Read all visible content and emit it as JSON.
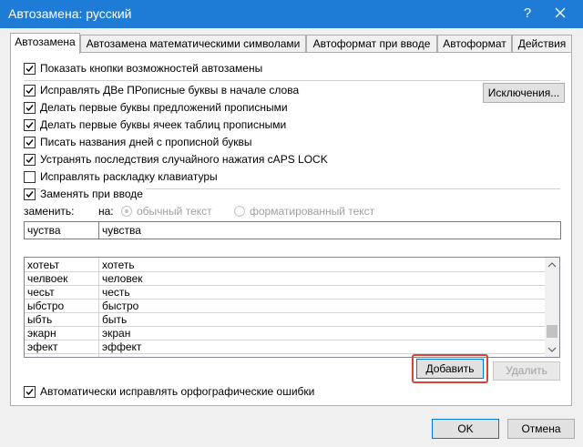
{
  "window": {
    "title": "Автозамена: русский",
    "help": "?"
  },
  "tabs": [
    "Автозамена",
    "Автозамена математическими символами",
    "Автоформат при вводе",
    "Автоформат",
    "Действия"
  ],
  "options": {
    "show_buttons": "Показать кнопки возможностей автозамены",
    "two_caps": "Исправлять ДВе ПРописные буквы в начале слова",
    "sentence_caps": "Делать первые буквы предложений прописными",
    "cell_caps": "Делать первые буквы ячеек таблиц прописными",
    "day_names": "Писать названия дней с прописной буквы",
    "caps_lock": "Устранять последствия случайного нажатия cAPS LOCK",
    "keyboard_layout": "Исправлять раскладку клавиатуры",
    "replace_as_type": "Заменять при вводе"
  },
  "exceptions_button": "Исключения...",
  "replace": {
    "label_replace": "заменить:",
    "label_with": "на:",
    "plain_text": "обычный текст",
    "formatted_text": "форматированный текст",
    "from_value": "чуства",
    "to_value": "чувства"
  },
  "list": [
    {
      "from": "хотеьт",
      "to": "хотеть"
    },
    {
      "from": "челвоек",
      "to": "человек"
    },
    {
      "from": "чесьт",
      "to": "честь"
    },
    {
      "from": "ыбстро",
      "to": "быстро"
    },
    {
      "from": "ыбть",
      "to": "быть"
    },
    {
      "from": "экарн",
      "to": "экран"
    },
    {
      "from": "эфект",
      "to": "эффект"
    }
  ],
  "buttons": {
    "add": "Добавить",
    "delete": "Удалить",
    "ok": "OK",
    "cancel": "Отмена"
  },
  "auto_spelling": "Автоматически исправлять орфографические ошибки",
  "colors": {
    "titlebar": "#1e7cd6",
    "highlight": "#d9413a",
    "default_button_border": "#0078d7"
  }
}
